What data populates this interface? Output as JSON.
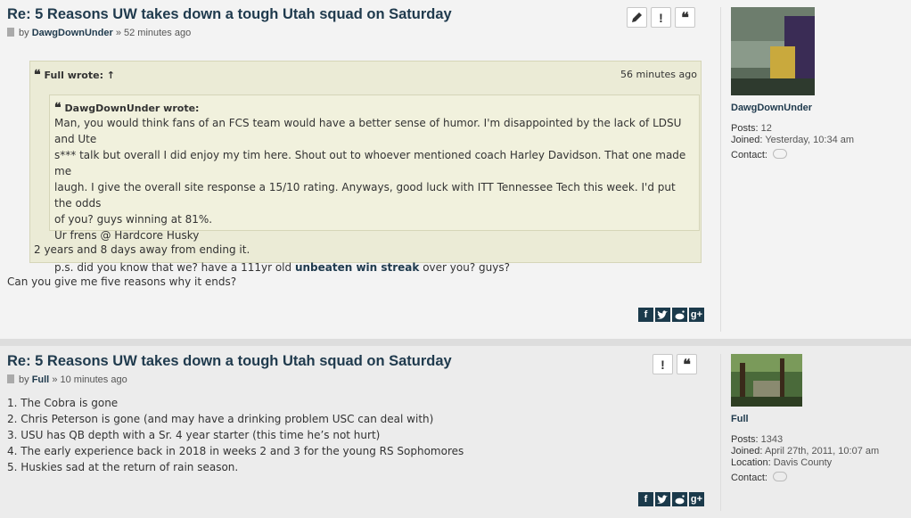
{
  "posts": [
    {
      "title": "Re: 5 Reasons UW takes down a tough Utah squad on Saturday",
      "by": "by",
      "author": "DawgDownUnder",
      "time": "» 52 minutes ago",
      "buttons": [
        "edit",
        "report",
        "quote"
      ],
      "quote": {
        "author_line": "Full wrote: ↑",
        "time": "56 minutes ago",
        "inner_author": "DawgDownUnder wrote:",
        "inner_lines": [
          "Man, you would think fans of an FCS team would have a better sense of humor. I'm disappointed by the lack of LDSU and Ute",
          "s*** talk but overall I did enjoy my tim here. Shout out to whoever mentioned coach Harley Davidson. That one made me",
          "laugh. I give the overall site response a 15/10 rating. Anyways, good luck with ITT Tennessee Tech this week. I'd put the odds",
          "of you? guys winning at 81%.",
          "Ur frens @ Hardcore Husky"
        ],
        "ps_pre": "p.s. did you know that we? have a 111yr old ",
        "ps_bold": "unbeaten win streak",
        "ps_post": " over you? guys?",
        "outer_reply": "2 years and 8 days away from ending it."
      },
      "body": "Can you give me five reasons why it ends?",
      "profile": {
        "username": "DawgDownUnder",
        "posts_label": "Posts:",
        "posts": "12",
        "joined_label": "Joined:",
        "joined": "Yesterday, 10:34 am",
        "contact_label": "Contact:"
      }
    },
    {
      "title": "Re: 5 Reasons UW takes down a tough Utah squad on Saturday",
      "by": "by",
      "author": "Full",
      "time": "» 10 minutes ago",
      "buttons": [
        "report",
        "quote"
      ],
      "lines": [
        "1. The Cobra is gone",
        "2. Chris Peterson is gone (and may have a drinking problem USC can deal with)",
        "3. USU has QB depth with a Sr. 4 year starter (this time he’s not hurt)",
        "4. The early experience back in 2018 in weeks 2 and 3 for the young RS Sophomores",
        "5. Huskies sad at the return of rain season."
      ],
      "profile": {
        "username": "Full",
        "posts_label": "Posts:",
        "posts": "1343",
        "joined_label": "Joined:",
        "joined": "April 27th, 2011, 10:07 am",
        "location_label": "Location:",
        "location": "Davis County",
        "contact_label": "Contact:"
      }
    }
  ],
  "share": {
    "facebook": "f",
    "twitter": "t",
    "reddit": "r",
    "google": "g+"
  },
  "icons": {
    "edit": "pencil-icon",
    "report": "exclamation-icon",
    "quote": "quote-icon"
  }
}
